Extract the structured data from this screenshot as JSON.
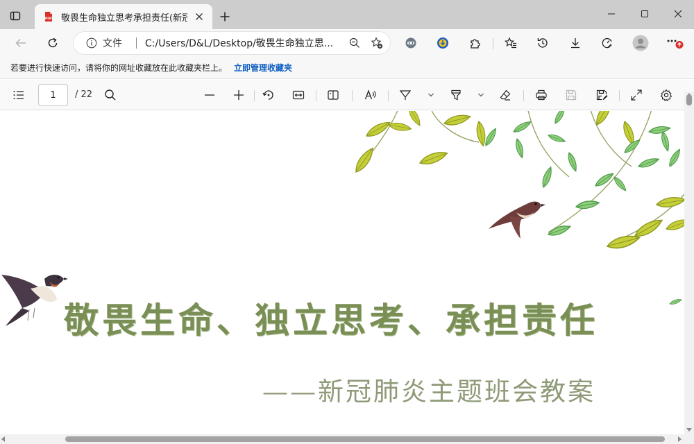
{
  "tab": {
    "title": "敬畏生命独立思考承担责任(新冠肺炎主题班会教案)",
    "favicon_text": "PDF"
  },
  "address": {
    "scheme_label": "文件",
    "url": "C:/Users/D&L/Desktop/敬畏生命独立思..."
  },
  "favorites_bar": {
    "message": "若要进行快速访问，请将你的网址收藏放在此收藏夹栏上。",
    "link": "立即管理收藏夹"
  },
  "pdf_toolbar": {
    "current_page": "1",
    "total_pages": "/ 22"
  },
  "document": {
    "title": "敬畏生命、独立思考、承担责任",
    "subtitle": "——新冠肺炎主题班会教案"
  },
  "colors": {
    "title_green": "#7a8f55",
    "subtitle_green": "#8f9a78",
    "link_blue": "#0f5fc2",
    "tab_strip": "#cdcdcd",
    "pdf_red": "#d9302c"
  },
  "icons": {
    "tab_actions": "tab-actions-icon",
    "close": "close-icon",
    "new_tab": "plus-icon",
    "back": "back-arrow-icon",
    "refresh": "refresh-icon",
    "info": "info-icon",
    "zoom": "zoom-out-icon",
    "favorite": "star-add-icon",
    "extensions": "puzzle-icon",
    "favorites": "favorites-icon",
    "history": "history-icon",
    "downloads": "download-icon",
    "performance": "performance-icon",
    "profile": "profile-icon",
    "menu": "more-icon"
  }
}
